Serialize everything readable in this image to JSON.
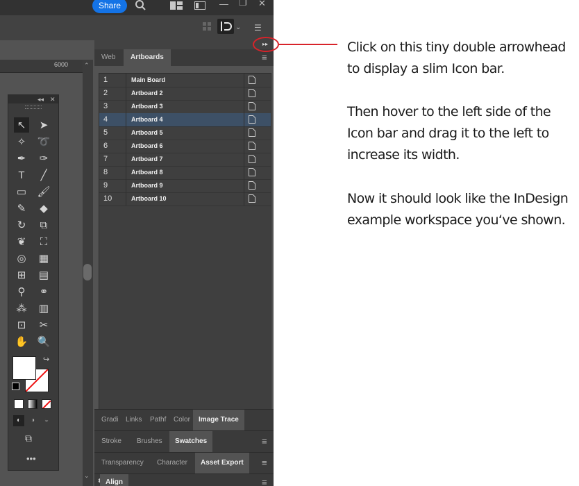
{
  "topbar": {
    "share_label": "Share"
  },
  "canvas": {
    "ruler_label": "6000"
  },
  "panel": {
    "tabs": [
      {
        "label": "Web"
      },
      {
        "label": "Artboards"
      }
    ],
    "artboards": [
      {
        "num": "1",
        "name": "Main Board"
      },
      {
        "num": "2",
        "name": "Artboard 2"
      },
      {
        "num": "3",
        "name": "Artboard 3"
      },
      {
        "num": "4",
        "name": "Artboard 4"
      },
      {
        "num": "5",
        "name": "Artboard 5"
      },
      {
        "num": "6",
        "name": "Artboard 6"
      },
      {
        "num": "7",
        "name": "Artboard 7"
      },
      {
        "num": "8",
        "name": "Artboard 8"
      },
      {
        "num": "9",
        "name": "Artboard 9"
      },
      {
        "num": "10",
        "name": "Artboard 10"
      }
    ],
    "selected_index": 3,
    "group1": [
      "Gradi",
      "Links",
      "Pathf",
      "Color",
      "Image Trace"
    ],
    "group2": [
      "Stroke",
      "Brushes",
      "Swatches"
    ],
    "group3": [
      "Transparency",
      "Character",
      "Asset Export"
    ],
    "group4": [
      "Align"
    ]
  },
  "annotation": {
    "p1": [
      "Click on this tiny double arrowhead",
      "to display a slim Icon bar."
    ],
    "p2": [
      "Then hover to the left side of the",
      "Icon bar and drag it to the left to",
      "increase its width."
    ],
    "p3": [
      "Now it should look like the InDesign",
      "example workspace you‘ve shown."
    ]
  },
  "colors": {
    "accent": "#1473e6",
    "selection": "#3d5066",
    "annotation_red": "#d8232a"
  }
}
